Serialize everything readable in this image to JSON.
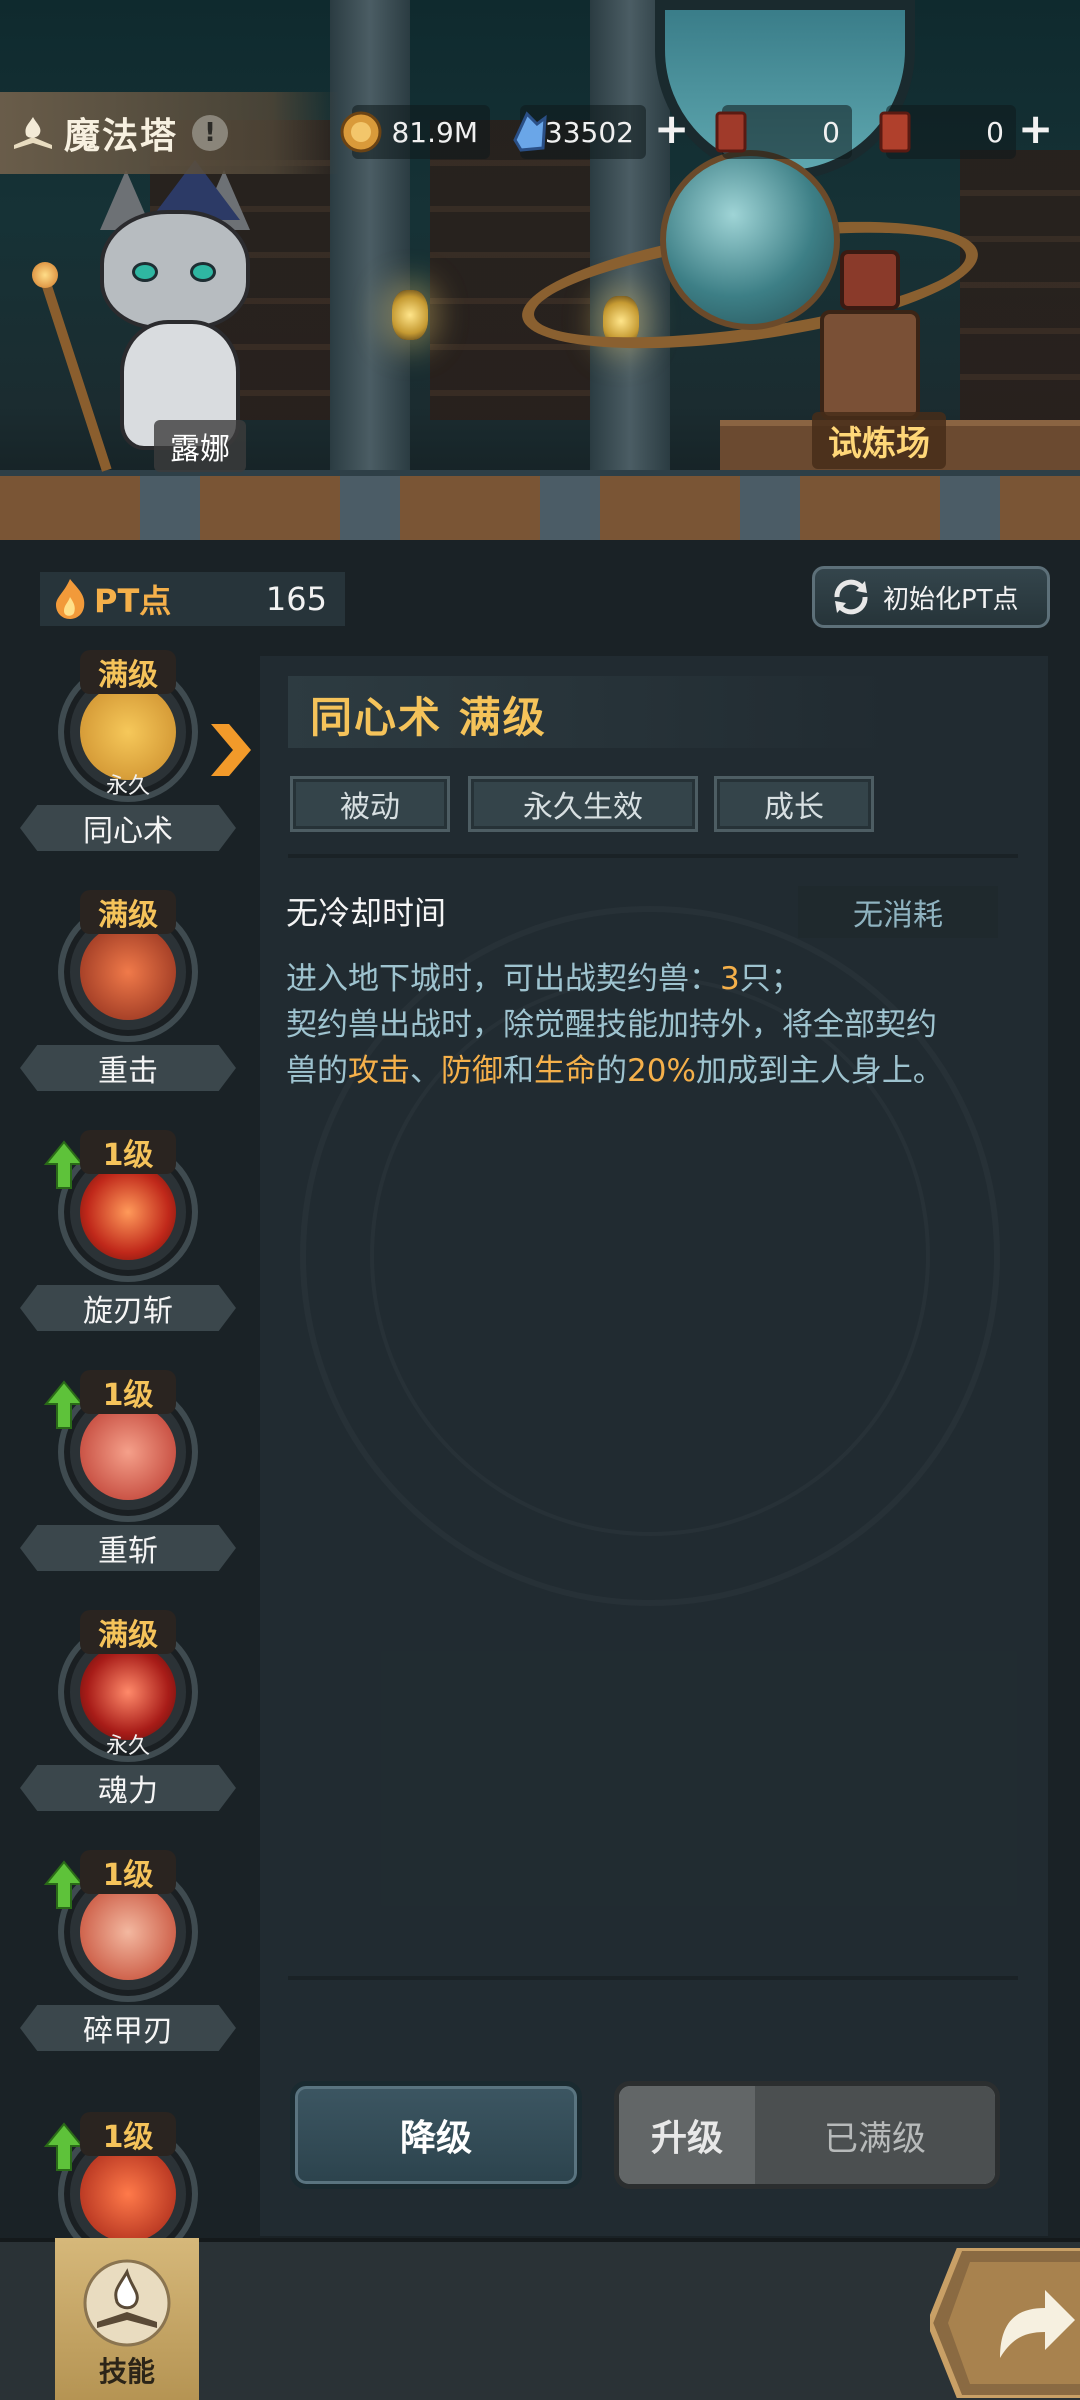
{
  "hud": {
    "title": "魔法塔",
    "info_icon": "!",
    "gold": "81.9M",
    "crystal": "33502",
    "ticket_a": "0",
    "ticket_b": "0"
  },
  "scene": {
    "npc_left": "露娜",
    "npc_right": "试炼场"
  },
  "pt": {
    "label": "PT点",
    "value": "165",
    "reset_label": "初始化PT点"
  },
  "skills": [
    {
      "name": "同心术",
      "level": "满级",
      "perm": "永久"
    },
    {
      "name": "重击",
      "level": "满级",
      "perm": ""
    },
    {
      "name": "旋刃斩",
      "level": "1级",
      "perm": ""
    },
    {
      "name": "重斩",
      "level": "1级",
      "perm": ""
    },
    {
      "name": "魂力",
      "level": "满级",
      "perm": "永久"
    },
    {
      "name": "碎甲刃",
      "level": "1级",
      "perm": ""
    },
    {
      "name": "",
      "level": "1级",
      "perm": ""
    }
  ],
  "detail": {
    "title": "同心术 满级",
    "tags": [
      "被动",
      "永久生效",
      "成长"
    ],
    "cooldown": "无冷却时间",
    "cost": "无消耗",
    "line1_a": "进入地下城时，可出战契约兽：",
    "line1_num": "3",
    "line1_b": "只；",
    "line2": "契约兽出战时，除觉醒技能加持外，将全部契约",
    "line3_a": "兽的",
    "line3_atk": "攻击",
    "line3_sep1": "、",
    "line3_def": "防御",
    "line3_and": "和",
    "line3_hp": "生命",
    "line3_of": "的",
    "line3_pct": "20%",
    "line3_b": "加成到主人身上。",
    "downgrade": "降级",
    "upgrade": "升级",
    "maxed": "已满级"
  },
  "bottom": {
    "skill_tab": "技能"
  },
  "colors": {
    "gold_text": "#f5c35a",
    "highlight": "#f5b04a",
    "desc": "#9ec3cf"
  }
}
